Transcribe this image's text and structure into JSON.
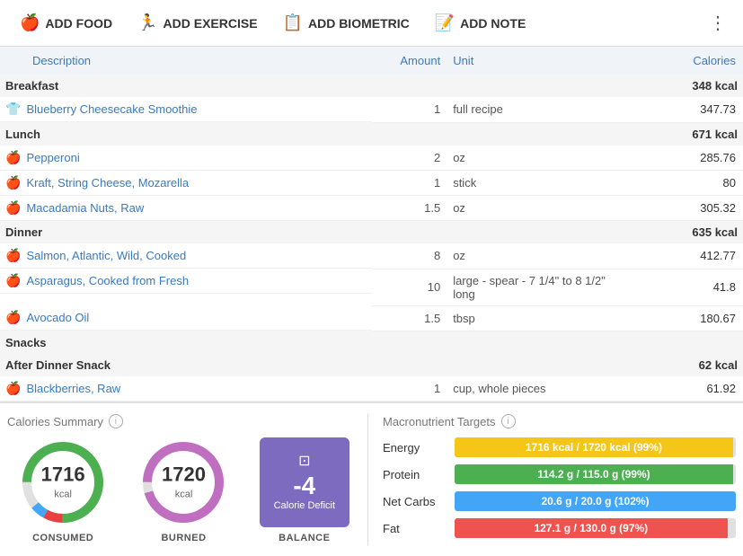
{
  "header": {
    "add_food_label": "ADD FOOD",
    "add_exercise_label": "ADD EXERCISE",
    "add_biometric_label": "ADD BIOMETRIC",
    "add_note_label": "ADD NOTE",
    "more_icon": "⋮"
  },
  "table": {
    "col_description": "Description",
    "col_amount": "Amount",
    "col_unit": "Unit",
    "col_calories": "Calories"
  },
  "meals": [
    {
      "name": "Breakfast",
      "kcal": "348 kcal",
      "foods": [
        {
          "icon": "shirt",
          "name": "Blueberry Cheesecake Smoothie",
          "amount": "1",
          "unit": "full recipe",
          "calories": "347.73"
        }
      ]
    },
    {
      "name": "Lunch",
      "kcal": "671 kcal",
      "foods": [
        {
          "icon": "apple",
          "name": "Pepperoni",
          "amount": "2",
          "unit": "oz",
          "calories": "285.76"
        },
        {
          "icon": "apple",
          "name": "Kraft, String Cheese, Mozarella",
          "amount": "1",
          "unit": "stick",
          "calories": "80"
        },
        {
          "icon": "apple",
          "name": "Macadamia Nuts, Raw",
          "amount": "1.5",
          "unit": "oz",
          "calories": "305.32"
        }
      ]
    },
    {
      "name": "Dinner",
      "kcal": "635 kcal",
      "foods": [
        {
          "icon": "apple",
          "name": "Salmon, Atlantic, Wild, Cooked",
          "amount": "8",
          "unit": "oz",
          "calories": "412.77"
        },
        {
          "icon": "apple",
          "name": "Asparagus, Cooked from Fresh",
          "amount": "10",
          "unit": "large - spear - 7 1/4\" to 8 1/2\" long",
          "calories": "41.8"
        },
        {
          "icon": "apple",
          "name": "Avocado Oil",
          "amount": "1.5",
          "unit": "tbsp",
          "calories": "180.67"
        }
      ]
    },
    {
      "name": "Snacks",
      "kcal": "",
      "foods": []
    },
    {
      "name": "After Dinner Snack",
      "kcal": "62 kcal",
      "foods": [
        {
          "icon": "apple",
          "name": "Blackberries, Raw",
          "amount": "1",
          "unit": "cup, whole pieces",
          "calories": "61.92"
        }
      ]
    }
  ],
  "calories_summary": {
    "title": "Calories Summary",
    "consumed_label": "CONSUMED",
    "burned_label": "BURNED",
    "balance_label": "BALANCE",
    "consumed_value": "1716",
    "consumed_unit": "kcal",
    "burned_value": "1720",
    "burned_unit": "kcal",
    "balance_value": "-4",
    "balance_subtitle": "Calorie Deficit"
  },
  "macros": {
    "title": "Macronutrient Targets",
    "rows": [
      {
        "name": "Energy",
        "label": "1716 kcal / 1720 kcal (99%)",
        "color": "#f5c518",
        "pct": 99
      },
      {
        "name": "Protein",
        "label": "114.2 g / 115.0 g (99%)",
        "color": "#4caf50",
        "pct": 99
      },
      {
        "name": "Net Carbs",
        "label": "20.6 g / 20.0 g (102%)",
        "color": "#42a5f5",
        "pct": 100
      },
      {
        "name": "Fat",
        "label": "127.1 g / 130.0 g (97%)",
        "color": "#ef5350",
        "pct": 97
      }
    ]
  }
}
